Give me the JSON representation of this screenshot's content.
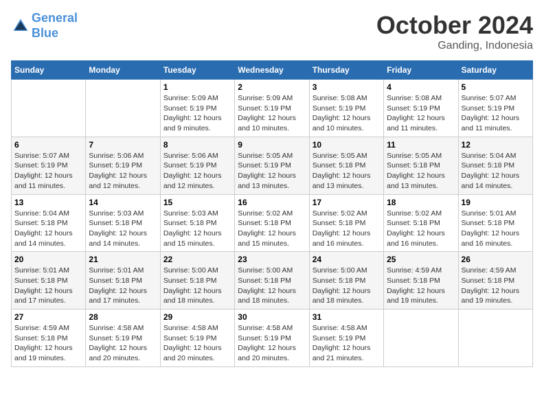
{
  "header": {
    "logo_line1": "General",
    "logo_line2": "Blue",
    "month": "October 2024",
    "location": "Ganding, Indonesia"
  },
  "days_of_week": [
    "Sunday",
    "Monday",
    "Tuesday",
    "Wednesday",
    "Thursday",
    "Friday",
    "Saturday"
  ],
  "weeks": [
    [
      {
        "day": "",
        "info": ""
      },
      {
        "day": "",
        "info": ""
      },
      {
        "day": "1",
        "sunrise": "5:09 AM",
        "sunset": "5:19 PM",
        "daylight": "12 hours and 9 minutes."
      },
      {
        "day": "2",
        "sunrise": "5:09 AM",
        "sunset": "5:19 PM",
        "daylight": "12 hours and 10 minutes."
      },
      {
        "day": "3",
        "sunrise": "5:08 AM",
        "sunset": "5:19 PM",
        "daylight": "12 hours and 10 minutes."
      },
      {
        "day": "4",
        "sunrise": "5:08 AM",
        "sunset": "5:19 PM",
        "daylight": "12 hours and 11 minutes."
      },
      {
        "day": "5",
        "sunrise": "5:07 AM",
        "sunset": "5:19 PM",
        "daylight": "12 hours and 11 minutes."
      }
    ],
    [
      {
        "day": "6",
        "sunrise": "5:07 AM",
        "sunset": "5:19 PM",
        "daylight": "12 hours and 11 minutes."
      },
      {
        "day": "7",
        "sunrise": "5:06 AM",
        "sunset": "5:19 PM",
        "daylight": "12 hours and 12 minutes."
      },
      {
        "day": "8",
        "sunrise": "5:06 AM",
        "sunset": "5:19 PM",
        "daylight": "12 hours and 12 minutes."
      },
      {
        "day": "9",
        "sunrise": "5:05 AM",
        "sunset": "5:19 PM",
        "daylight": "12 hours and 13 minutes."
      },
      {
        "day": "10",
        "sunrise": "5:05 AM",
        "sunset": "5:18 PM",
        "daylight": "12 hours and 13 minutes."
      },
      {
        "day": "11",
        "sunrise": "5:05 AM",
        "sunset": "5:18 PM",
        "daylight": "12 hours and 13 minutes."
      },
      {
        "day": "12",
        "sunrise": "5:04 AM",
        "sunset": "5:18 PM",
        "daylight": "12 hours and 14 minutes."
      }
    ],
    [
      {
        "day": "13",
        "sunrise": "5:04 AM",
        "sunset": "5:18 PM",
        "daylight": "12 hours and 14 minutes."
      },
      {
        "day": "14",
        "sunrise": "5:03 AM",
        "sunset": "5:18 PM",
        "daylight": "12 hours and 14 minutes."
      },
      {
        "day": "15",
        "sunrise": "5:03 AM",
        "sunset": "5:18 PM",
        "daylight": "12 hours and 15 minutes."
      },
      {
        "day": "16",
        "sunrise": "5:02 AM",
        "sunset": "5:18 PM",
        "daylight": "12 hours and 15 minutes."
      },
      {
        "day": "17",
        "sunrise": "5:02 AM",
        "sunset": "5:18 PM",
        "daylight": "12 hours and 16 minutes."
      },
      {
        "day": "18",
        "sunrise": "5:02 AM",
        "sunset": "5:18 PM",
        "daylight": "12 hours and 16 minutes."
      },
      {
        "day": "19",
        "sunrise": "5:01 AM",
        "sunset": "5:18 PM",
        "daylight": "12 hours and 16 minutes."
      }
    ],
    [
      {
        "day": "20",
        "sunrise": "5:01 AM",
        "sunset": "5:18 PM",
        "daylight": "12 hours and 17 minutes."
      },
      {
        "day": "21",
        "sunrise": "5:01 AM",
        "sunset": "5:18 PM",
        "daylight": "12 hours and 17 minutes."
      },
      {
        "day": "22",
        "sunrise": "5:00 AM",
        "sunset": "5:18 PM",
        "daylight": "12 hours and 18 minutes."
      },
      {
        "day": "23",
        "sunrise": "5:00 AM",
        "sunset": "5:18 PM",
        "daylight": "12 hours and 18 minutes."
      },
      {
        "day": "24",
        "sunrise": "5:00 AM",
        "sunset": "5:18 PM",
        "daylight": "12 hours and 18 minutes."
      },
      {
        "day": "25",
        "sunrise": "4:59 AM",
        "sunset": "5:18 PM",
        "daylight": "12 hours and 19 minutes."
      },
      {
        "day": "26",
        "sunrise": "4:59 AM",
        "sunset": "5:18 PM",
        "daylight": "12 hours and 19 minutes."
      }
    ],
    [
      {
        "day": "27",
        "sunrise": "4:59 AM",
        "sunset": "5:18 PM",
        "daylight": "12 hours and 19 minutes."
      },
      {
        "day": "28",
        "sunrise": "4:58 AM",
        "sunset": "5:19 PM",
        "daylight": "12 hours and 20 minutes."
      },
      {
        "day": "29",
        "sunrise": "4:58 AM",
        "sunset": "5:19 PM",
        "daylight": "12 hours and 20 minutes."
      },
      {
        "day": "30",
        "sunrise": "4:58 AM",
        "sunset": "5:19 PM",
        "daylight": "12 hours and 20 minutes."
      },
      {
        "day": "31",
        "sunrise": "4:58 AM",
        "sunset": "5:19 PM",
        "daylight": "12 hours and 21 minutes."
      },
      {
        "day": "",
        "info": ""
      },
      {
        "day": "",
        "info": ""
      }
    ]
  ],
  "labels": {
    "sunrise": "Sunrise: ",
    "sunset": "Sunset: ",
    "daylight": "Daylight: "
  }
}
